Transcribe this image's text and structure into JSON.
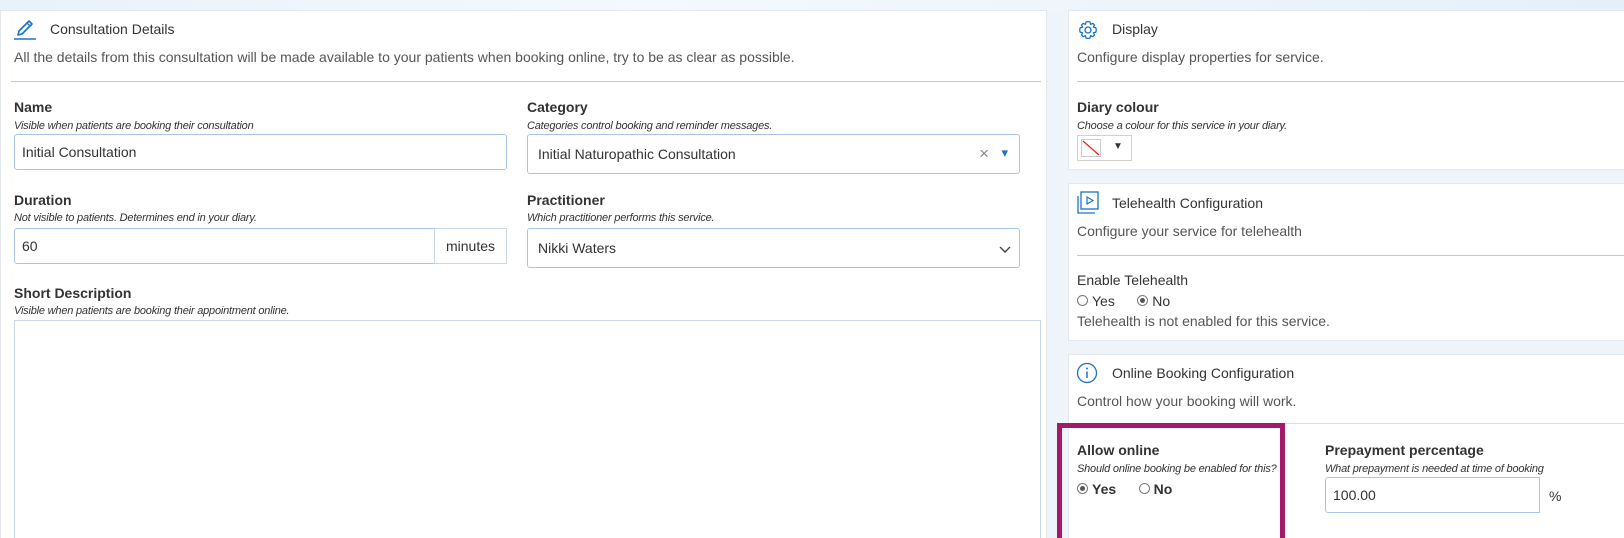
{
  "consultation": {
    "title": "Consultation Details",
    "description": "All the details from this consultation will be made available to your patients when booking online, try to be as clear as possible.",
    "name": {
      "label": "Name",
      "hint": "Visible when patients are booking their consultation",
      "value": "Initial Consultation"
    },
    "category": {
      "label": "Category",
      "hint": "Categories control booking and reminder messages.",
      "value": "Initial Naturopathic Consultation",
      "clear": "×",
      "caret": "▾"
    },
    "duration": {
      "label": "Duration",
      "hint": "Not visible to patients. Determines end in your diary.",
      "value": "60",
      "unit": "minutes"
    },
    "practitioner": {
      "label": "Practitioner",
      "hint": "Which practitioner performs this service.",
      "value": "Nikki Waters"
    },
    "short_description": {
      "label": "Short Description",
      "hint": "Visible when patients are booking their appointment online.",
      "value": ""
    }
  },
  "display": {
    "title": "Display",
    "description": "Configure display properties for service.",
    "diary_colour": {
      "label": "Diary colour",
      "hint": "Choose a colour for this service in your diary.",
      "caret": "▼"
    }
  },
  "telehealth": {
    "title": "Telehealth Configuration",
    "description": "Configure your service for telehealth",
    "enable_label": "Enable Telehealth",
    "yes": "Yes",
    "no": "No",
    "selected": "no",
    "status": "Telehealth is not enabled for this service."
  },
  "online_booking": {
    "title": "Online Booking Configuration",
    "description": "Control how your booking will work.",
    "allow_online": {
      "label": "Allow online",
      "hint": "Should online booking be enabled for this?",
      "yes": "Yes",
      "no": "No",
      "selected": "yes"
    },
    "prepayment": {
      "label": "Prepayment percentage",
      "hint": "What prepayment is needed at time of booking",
      "value": "100.00",
      "unit": "%"
    }
  },
  "colors": {
    "accent": "#1a73c8",
    "highlight": "#a6196a",
    "field_border": "#a9c6e8"
  },
  "icons": {
    "consultation": "pencil-icon",
    "display": "gear-icon",
    "telehealth": "video-icon",
    "online_booking": "info-icon"
  }
}
